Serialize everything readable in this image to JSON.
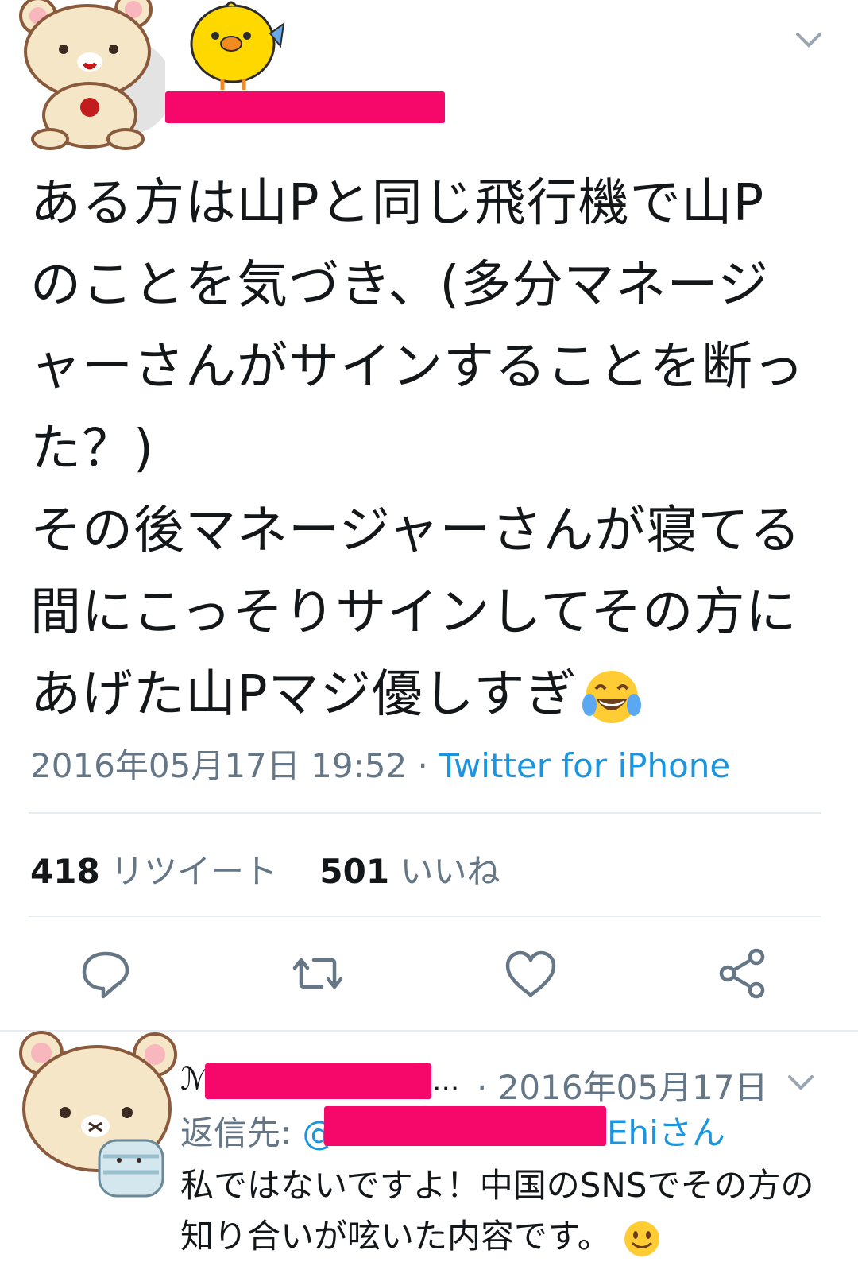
{
  "tweet": {
    "text_lines": [
      "ある方は山Pと同じ飛行機で山P",
      "のことを気づき、(多分マネージ",
      "ャーさんがサインすることを断っ",
      "た？)",
      "その後マネージャーさんが寝てる",
      "間にこっそりサインしてその方に",
      "あげた山Pマジ優しすぎ"
    ],
    "emoji": "face-with-tears-of-joy",
    "timestamp": "2016年05月17日 19:52",
    "separator": " · ",
    "source": "Twitter for iPhone",
    "retweet_count": "418",
    "retweet_label": "リツイート",
    "like_count": "501",
    "like_label": "いいね"
  },
  "actions": [
    "reply-icon",
    "retweet-icon",
    "like-icon",
    "share-icon"
  ],
  "reply": {
    "name_prefix": "ℳ",
    "name_ellipsis": "...",
    "date": "· 2016年05月17日",
    "reply_to_label": "返信先: ",
    "reply_to_at": "@",
    "reply_to_suffix": "Ehiさん",
    "text": "私ではないですよ！中国のSNSでその方の知り合いが呟いた内容です。",
    "emoji": "slightly-smiling-face"
  },
  "colors": {
    "link": "#1b95e0",
    "secondary_text": "#657786",
    "redaction": "#f5086a",
    "divider": "#e6ecf0"
  }
}
